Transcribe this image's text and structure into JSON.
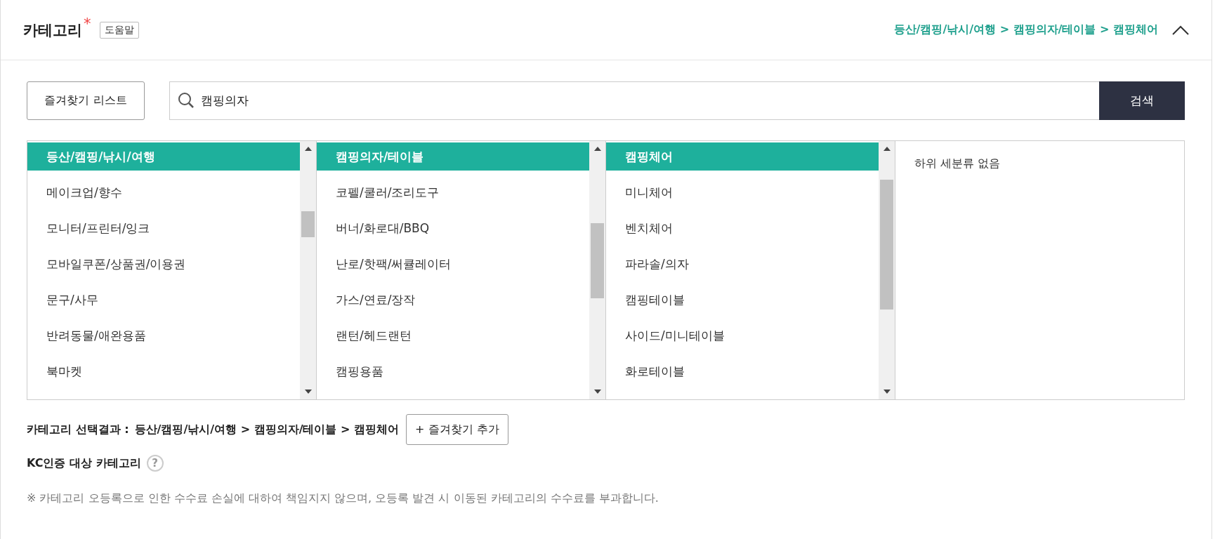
{
  "header": {
    "title": "카테고리",
    "required_mark": "*",
    "help_badge": "도움말",
    "breadcrumb": "등산/캠핑/낚시/여행 > 캠핑의자/테이블 > 캠핑체어",
    "expanded": true
  },
  "favorites_button": "즐겨찾기 리스트",
  "search": {
    "value": "캠핑의자",
    "button": "검색"
  },
  "columns": [
    {
      "items": [
        {
          "label": "등산/캠핑/낚시/여행",
          "selected": true
        },
        {
          "label": "메이크업/향수",
          "selected": false
        },
        {
          "label": "모니터/프린터/잉크",
          "selected": false
        },
        {
          "label": "모바일쿠폰/상품권/이용권",
          "selected": false
        },
        {
          "label": "문구/사무",
          "selected": false
        },
        {
          "label": "반려동물/애완용품",
          "selected": false
        },
        {
          "label": "북마켓",
          "selected": false
        }
      ]
    },
    {
      "items": [
        {
          "label": "캠핑의자/테이블",
          "selected": true
        },
        {
          "label": "코펠/쿨러/조리도구",
          "selected": false
        },
        {
          "label": "버너/화로대/BBQ",
          "selected": false
        },
        {
          "label": "난로/핫팩/써큘레이터",
          "selected": false
        },
        {
          "label": "가스/연료/장작",
          "selected": false
        },
        {
          "label": "랜턴/헤드랜턴",
          "selected": false
        },
        {
          "label": "캠핑용품",
          "selected": false
        }
      ]
    },
    {
      "items": [
        {
          "label": "캠핑체어",
          "selected": true
        },
        {
          "label": "미니체어",
          "selected": false
        },
        {
          "label": "벤치체어",
          "selected": false
        },
        {
          "label": "파라솔/의자",
          "selected": false
        },
        {
          "label": "캠핑테이블",
          "selected": false
        },
        {
          "label": "사이드/미니테이블",
          "selected": false
        },
        {
          "label": "화로테이블",
          "selected": false
        }
      ]
    },
    {
      "empty_message": "하위 세분류 없음"
    }
  ],
  "result": {
    "label": "카테고리 선택결과 :",
    "path": "등산/캠핑/낚시/여행 > 캠핑의자/테이블 > 캠핑체어",
    "add_favorite_button": "+ 즐겨찾기 추가"
  },
  "kc": {
    "label": "KC인증 대상 카테고리",
    "help": "?"
  },
  "notice": "※ 카테고리 오등록으로 인한 수수료 손실에 대하여 책임지지 않으며, 오등록 발견 시 이동된 카테고리의 수수료를 부과합니다."
}
